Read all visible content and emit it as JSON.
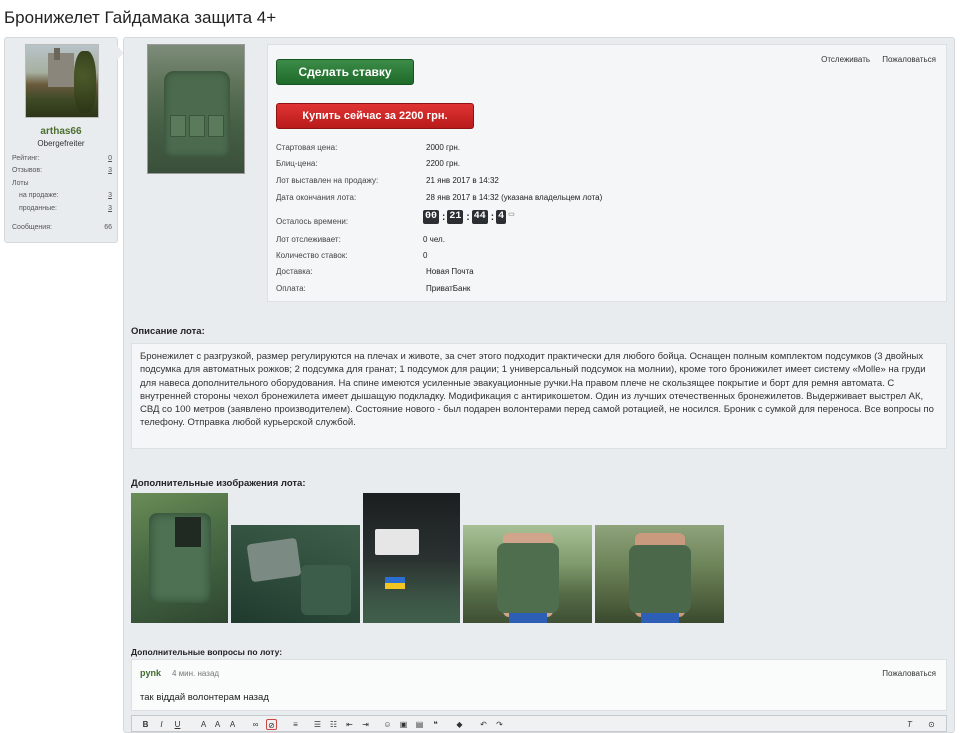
{
  "page": {
    "title": "Бронижелет Гайдамака защита 4+"
  },
  "user": {
    "name": "arthas66",
    "title": "Obergefreiter",
    "stats": [
      {
        "label": "Рейтинг:",
        "value": "0"
      },
      {
        "label": "Отзывов:",
        "value": "3"
      },
      {
        "label": "Лоты",
        "value": ""
      },
      {
        "label": "на продаже:",
        "value": "3"
      },
      {
        "label": "проданные:",
        "value": "3"
      },
      {
        "label": "Сообщения:",
        "value": "66"
      }
    ]
  },
  "lot": {
    "watch_link": "Отслеживать",
    "report_link": "Пожаловаться",
    "bid_button": "Сделать ставку",
    "buy_button": "Купить сейчас за 2200 грн.",
    "rows": [
      {
        "label": "Стартовая цена:",
        "value": "2000 грн."
      },
      {
        "label": "Блиц-цена:",
        "value": "2200 грн."
      },
      {
        "label": "Лот выставлен на продажу:",
        "value": "21 янв 2017 в 14:32"
      },
      {
        "label": "Дата окончания лота:",
        "value": "28 янв 2017 в 14:32 (указана владельцем лота)"
      },
      {
        "label": "Осталось времени:",
        "value": ""
      },
      {
        "label": "Лот отслеживает:",
        "value": "0 чел."
      },
      {
        "label": "Количество ставок:",
        "value": "0"
      },
      {
        "label": "Доставка:",
        "value": "Новая Почта"
      },
      {
        "label": "Оплата:",
        "value": "ПриватБанк"
      }
    ],
    "timer": {
      "days": "00",
      "hours": "21",
      "minutes": "44",
      "seconds": "4"
    }
  },
  "description": {
    "title": "Описание лота:",
    "text": "Бронежилет с разгрузкой, размер регулируются на плечах и животе, за счет этого подходит практически для любого бойца. Оснащен полным комплектом подсумков (3 двойных подсумка для автоматных рожков; 2 подсумка для гранат; 1 подсумок для рации; 1 универсальный подсумок на молнии), кроме того бронижилет имеет систему «Molle» на груди для навеса дополнительного оборудования. На спине имеются усиленные эвакуационные ручки.На правом плече не скользящее покрытие и борт для ремня автомата. С внутренней стороны чехол бронежилета имеет дышащую подкладку. Модификация с антирикошетом. Один из лучших отечественных бронежилетов. Выдерживает выстрел АК, СВД со 100 метров (заявлено производителем). Состояние нового - был подарен волонтерами перед самой ротацией, не носился. Броник с сумкой для переноса. Все вопросы по телефону. Отправка любой курьерской службой."
  },
  "images_section": {
    "title": "Дополнительные изображения лота:"
  },
  "questions": {
    "title": "Дополнительные вопросы по лоту:",
    "items": [
      {
        "user": "pynk",
        "time": "4 мин. назад",
        "report": "Пожаловаться",
        "text": "так віддай волонтерам назад"
      }
    ]
  },
  "colors": {
    "bid_green": "#1e6a2a",
    "buy_red": "#c21f1f",
    "username_green": "#4b6e2e"
  }
}
